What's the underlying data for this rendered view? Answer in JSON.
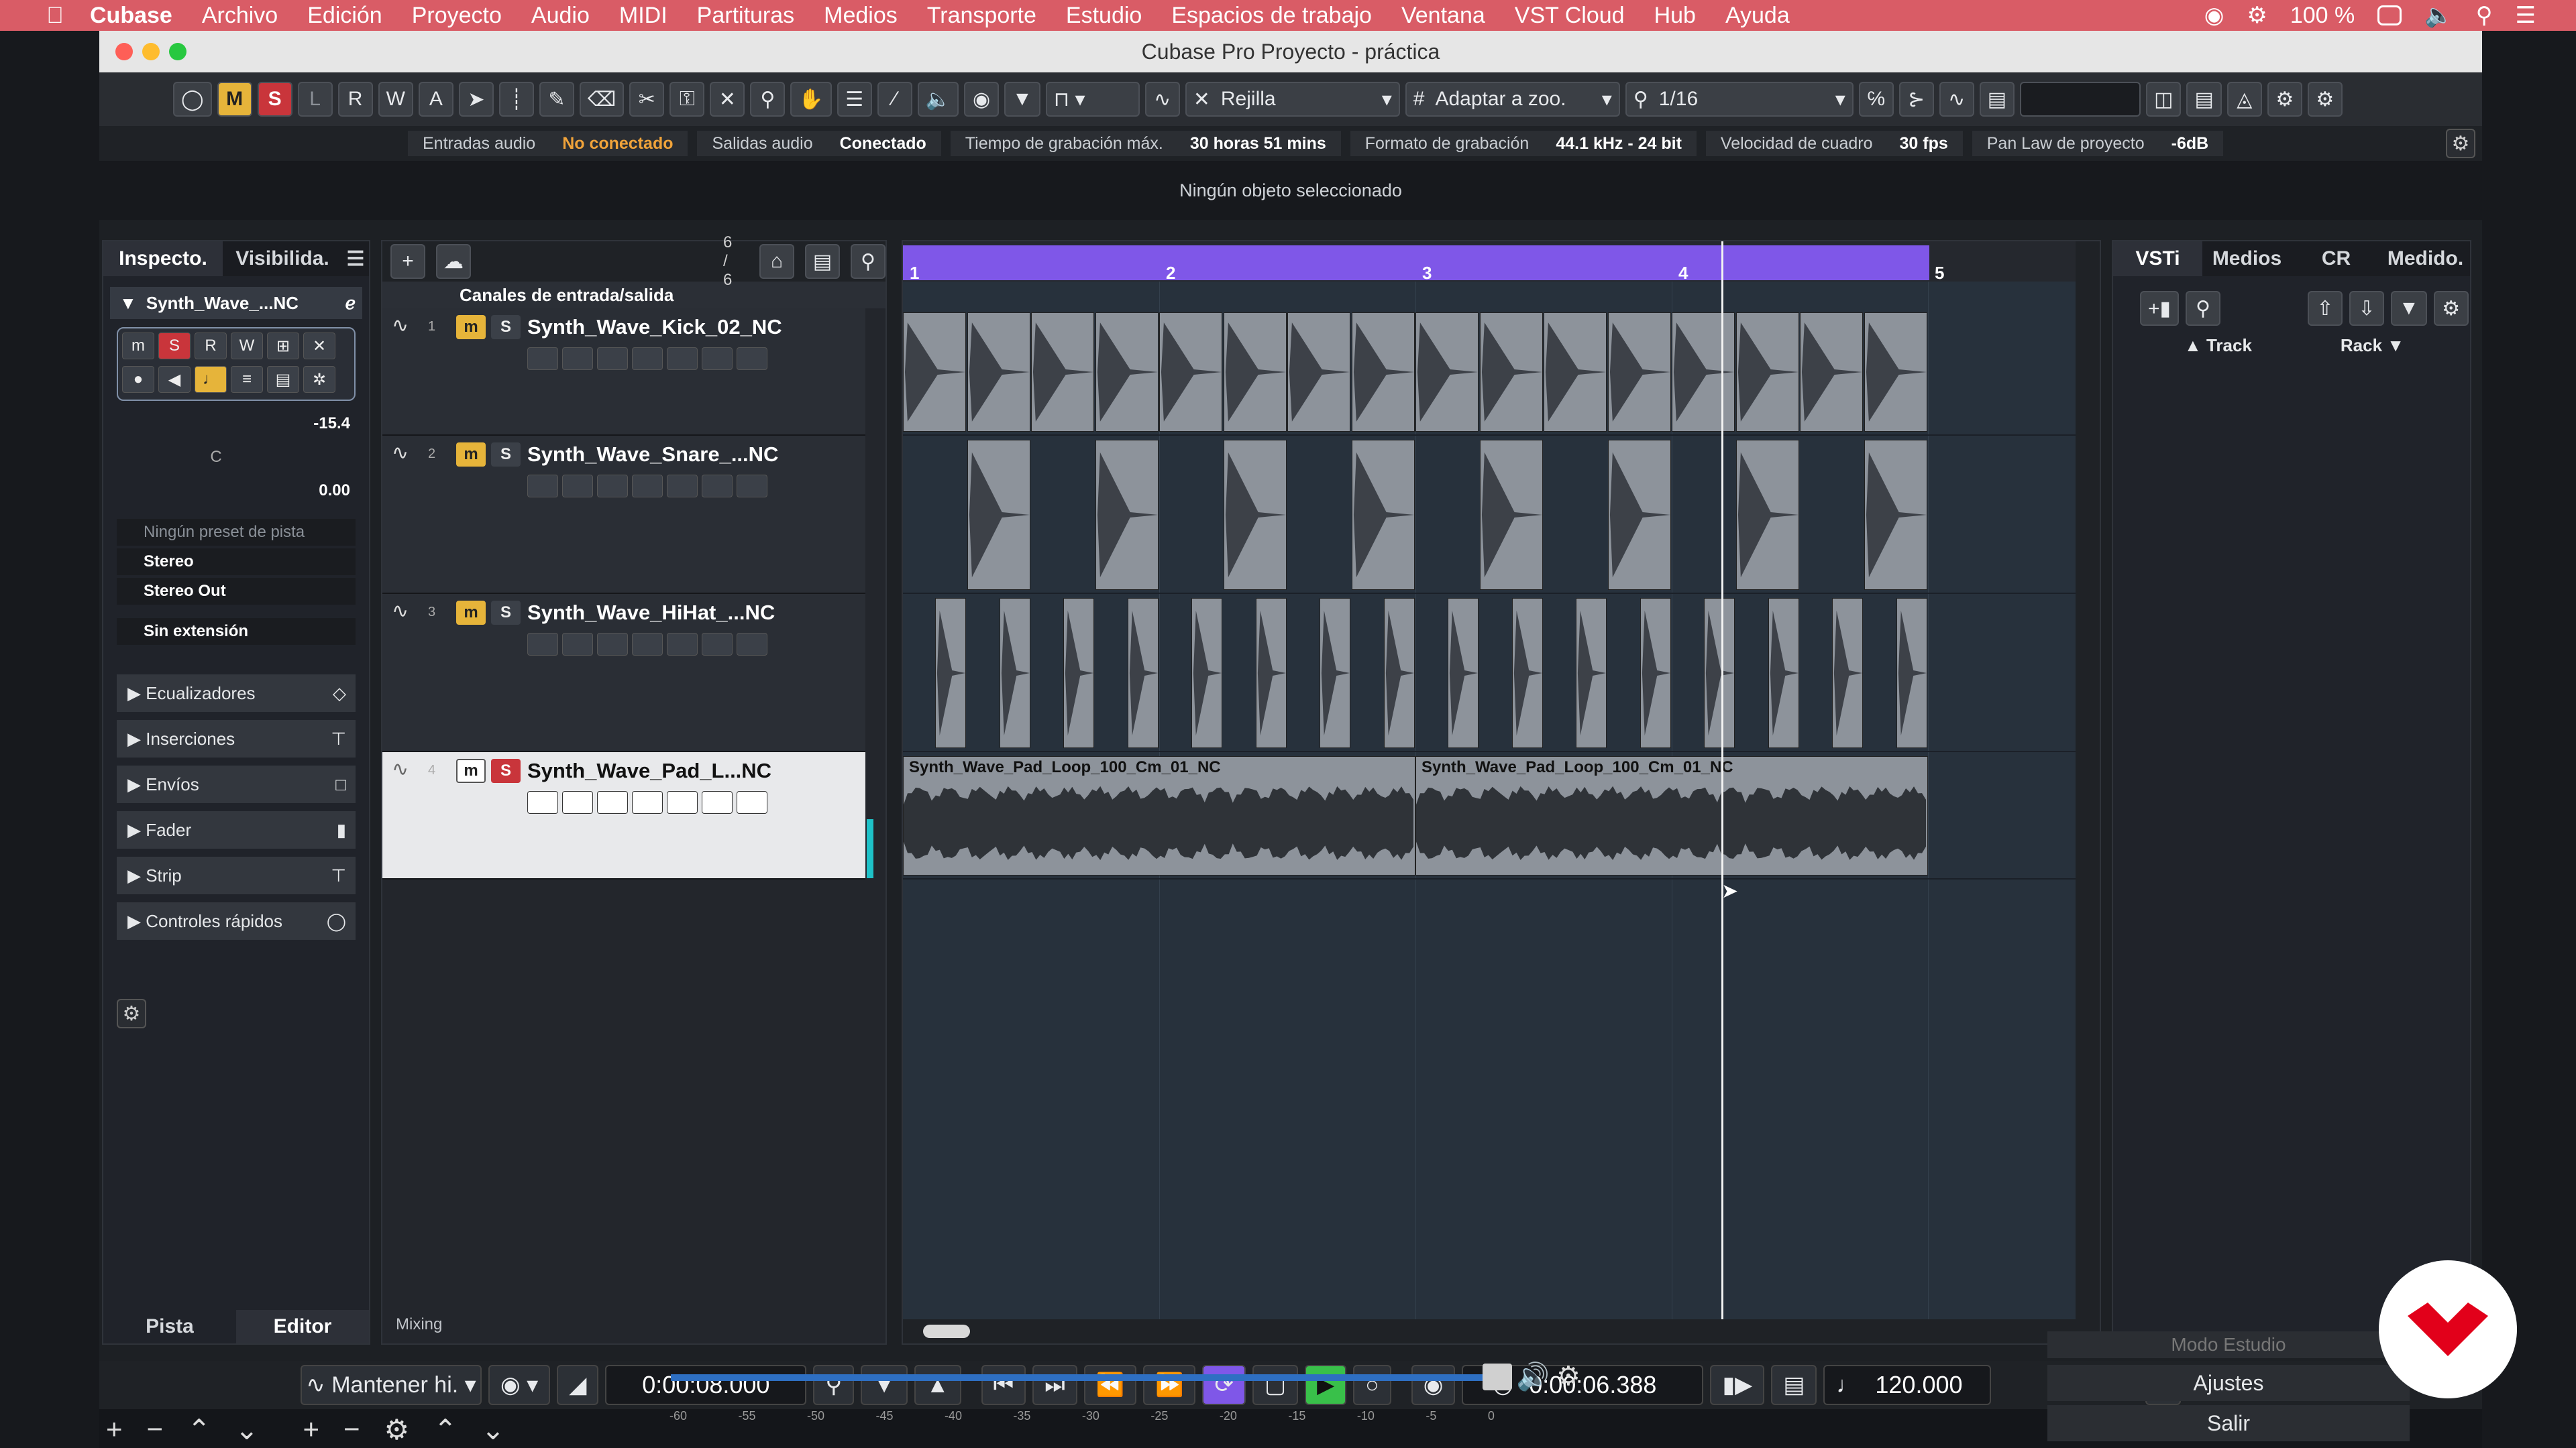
{
  "menubar": {
    "app": "Cubase",
    "items": [
      "Archivo",
      "Edición",
      "Proyecto",
      "Audio",
      "MIDI",
      "Partituras",
      "Medios",
      "Transporte",
      "Estudio",
      "Espacios de trabajo",
      "Ventana",
      "VST Cloud",
      "Hub",
      "Ayuda"
    ],
    "battery": "100 %"
  },
  "window": {
    "title": "Cubase Pro Proyecto - práctica"
  },
  "toolbar": {
    "m": "M",
    "s": "S",
    "l": "L",
    "r": "R",
    "w": "W",
    "a": "A",
    "snap_type": "Rejilla",
    "zoom_mode": "Adaptar a zoo.",
    "quantize": "1/16"
  },
  "status": [
    {
      "label": "Entradas audio",
      "value": "No conectado",
      "warn": true
    },
    {
      "label": "Salidas audio",
      "value": "Conectado"
    },
    {
      "label": "Tiempo de grabación máx.",
      "value": "30 horas 51 mins"
    },
    {
      "label": "Formato de grabación",
      "value": "44.1 kHz - 24 bit"
    },
    {
      "label": "Velocidad de cuadro",
      "value": "30 fps"
    },
    {
      "label": "Pan Law de proyecto",
      "value": "-6dB"
    }
  ],
  "info_line": "Ningún objeto seleccionado",
  "inspector": {
    "tabs": [
      "Inspecto.",
      "Visibilida."
    ],
    "track_name": "Synth_Wave_...NC",
    "volume": "-15.4",
    "pan_label": "C",
    "pan_value": "0.00",
    "preset": "Ningún preset de pista",
    "stereo": "Stereo",
    "output": "Stereo Out",
    "extension": "Sin extensión",
    "sections": [
      "Ecualizadores",
      "Inserciones",
      "Envíos",
      "Fader",
      "Strip",
      "Controles rápidos"
    ],
    "bottom_tabs": [
      "Pista",
      "Editor"
    ]
  },
  "tracklist": {
    "count": "6 / 6",
    "io": "Canales de entrada/salida",
    "tracks": [
      {
        "num": "1",
        "name": "Synth_Wave_Kick_02_NC"
      },
      {
        "num": "2",
        "name": "Synth_Wave_Snare_...NC"
      },
      {
        "num": "3",
        "name": "Synth_Wave_HiHat_...NC"
      },
      {
        "num": "4",
        "name": "Synth_Wave_Pad_L...NC"
      }
    ],
    "footer": "Mixing"
  },
  "arrange": {
    "bars": [
      "1",
      "2",
      "3",
      "4",
      "5"
    ],
    "pad_event": "Synth_Wave_Pad_Loop_100_Cm_01_NC"
  },
  "rightzone": {
    "tabs": [
      "VSTi",
      "Medios",
      "CR",
      "Medido."
    ],
    "col_track": "Track",
    "col_rack": "Rack"
  },
  "transport": {
    "mode": "Mantener hi.",
    "left_time": "0:00:08.000",
    "right_time": "0:00:06.388",
    "tempo": "120.000"
  },
  "lower": {
    "meter_ticks": [
      "-60",
      "-55",
      "-50",
      "-45",
      "-40",
      "-35",
      "-30",
      "-25",
      "-20",
      "-15",
      "-10",
      "-5",
      "0"
    ],
    "buttons": [
      "Modo Estudio",
      "Ajustes",
      "Salir"
    ]
  },
  "colors": {
    "cycle": "#7f57e8",
    "mute": "#e6b43a",
    "solo": "#c9353b",
    "play": "#39c04a",
    "logo_red": "#e2001a"
  }
}
